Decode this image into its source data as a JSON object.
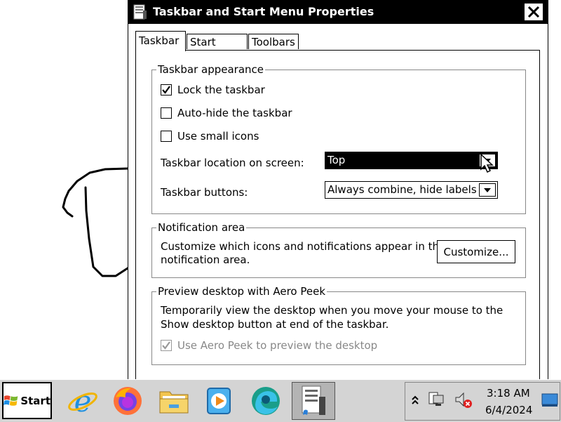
{
  "window": {
    "title": "Taskbar and Start Menu Properties"
  },
  "tabs": [
    {
      "label": "Taskbar",
      "active": true
    },
    {
      "label": "Start Menu",
      "active": false
    },
    {
      "label": "Toolbars",
      "active": false
    }
  ],
  "appearance": {
    "legend": "Taskbar appearance",
    "lock_label": "Lock the taskbar",
    "lock_checked": true,
    "autohide_label": "Auto-hide the taskbar",
    "autohide_checked": false,
    "small_icons_label": "Use small icons",
    "small_icons_checked": false,
    "location_label": "Taskbar location on screen:",
    "location_value": "Top",
    "buttons_label": "Taskbar buttons:",
    "buttons_value": "Always combine, hide labels"
  },
  "notification": {
    "legend": "Notification area",
    "text_line1": "Customize which icons and notifications appear in the",
    "text_line2": "notification area.",
    "customize_label": "Customize..."
  },
  "peek": {
    "legend": "Preview desktop with Aero Peek",
    "text_line1": "Temporarily view the desktop when you move your mouse to the",
    "text_line2": "Show desktop button at end of the taskbar.",
    "checkbox_label": "Use Aero Peek to preview the desktop",
    "checkbox_checked": true,
    "checkbox_disabled": true
  },
  "taskbar": {
    "start_label": "Start",
    "apps": [
      "internet-explorer",
      "firefox",
      "file-explorer",
      "media-player",
      "edge",
      "taskbar-properties"
    ],
    "time": "3:18 AM",
    "date": "6/4/2024"
  }
}
